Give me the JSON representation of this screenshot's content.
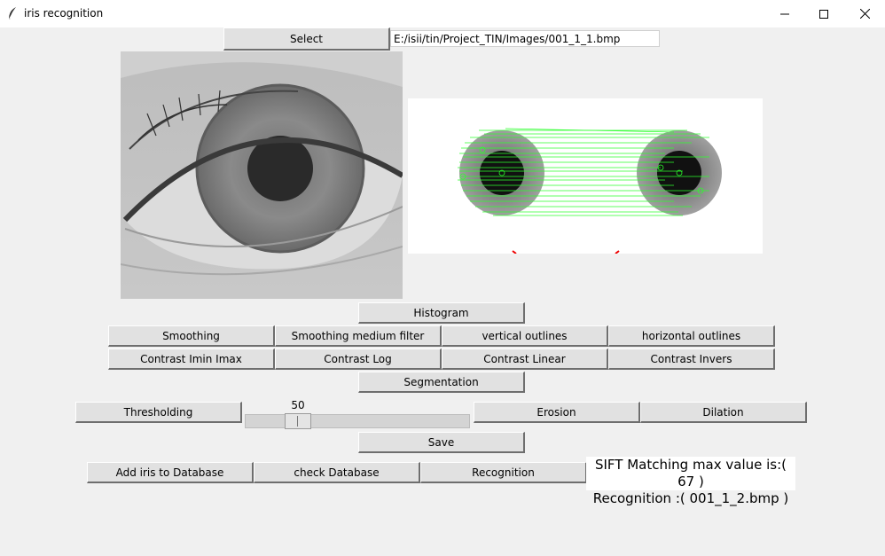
{
  "window": {
    "title": "iris recognition"
  },
  "controls": {
    "select_label": "Select",
    "file_path": "E:/isii/tin/Project_TIN/Images/001_1_1.bmp"
  },
  "buttons": {
    "histogram": "Histogram",
    "smoothing": "Smoothing",
    "smoothing_medium": "Smoothing medium filter",
    "vertical_outlines": "vertical outlines",
    "horizontal_outlines": "horizontal outlines",
    "contrast_minmax": "Contrast Imin Imax",
    "contrast_log": "Contrast Log",
    "contrast_linear": "Contrast Linear",
    "contrast_invers": "Contrast Invers",
    "segmentation": "Segmentation",
    "thresholding": "Thresholding",
    "erosion": "Erosion",
    "dilation": "Dilation",
    "save": "Save",
    "add_iris": "Add iris to Database",
    "check_db": "check Database",
    "recognition": "Recognition"
  },
  "slider": {
    "value": "50",
    "fraction": 0.2
  },
  "result": {
    "line1": "SIFT Matching max value is:( 67 )",
    "line2": "Recognition :( 001_1_2.bmp )"
  },
  "icons": {
    "app": "feather-icon",
    "minimize": "minimize-icon",
    "maximize": "maximize-icon",
    "close": "close-icon"
  }
}
